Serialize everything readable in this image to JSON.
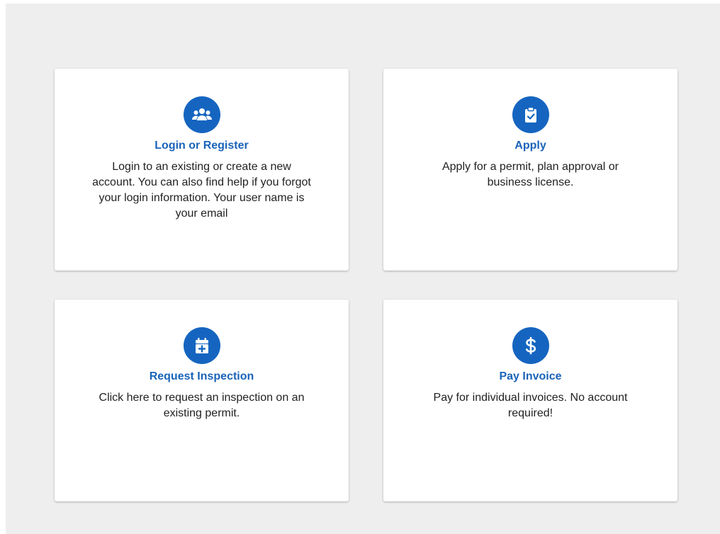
{
  "colors": {
    "background": "#eeeeee",
    "card": "#ffffff",
    "accent": "#1565c0",
    "title": "#1a63b8",
    "text": "#222222"
  },
  "cards": [
    {
      "icon": "users-icon",
      "title": "Login or Register",
      "description": "Login to an existing or create a new account. You can also find help if you forgot your login information. Your user name is your email"
    },
    {
      "icon": "clipboard-check-icon",
      "title": "Apply",
      "description": "Apply for a permit, plan approval or business license."
    },
    {
      "icon": "calendar-plus-icon",
      "title": "Request Inspection",
      "description": "Click here to request an inspection on an existing permit."
    },
    {
      "icon": "dollar-icon",
      "title": "Pay Invoice",
      "description": "Pay for individual invoices. No account required!"
    }
  ]
}
